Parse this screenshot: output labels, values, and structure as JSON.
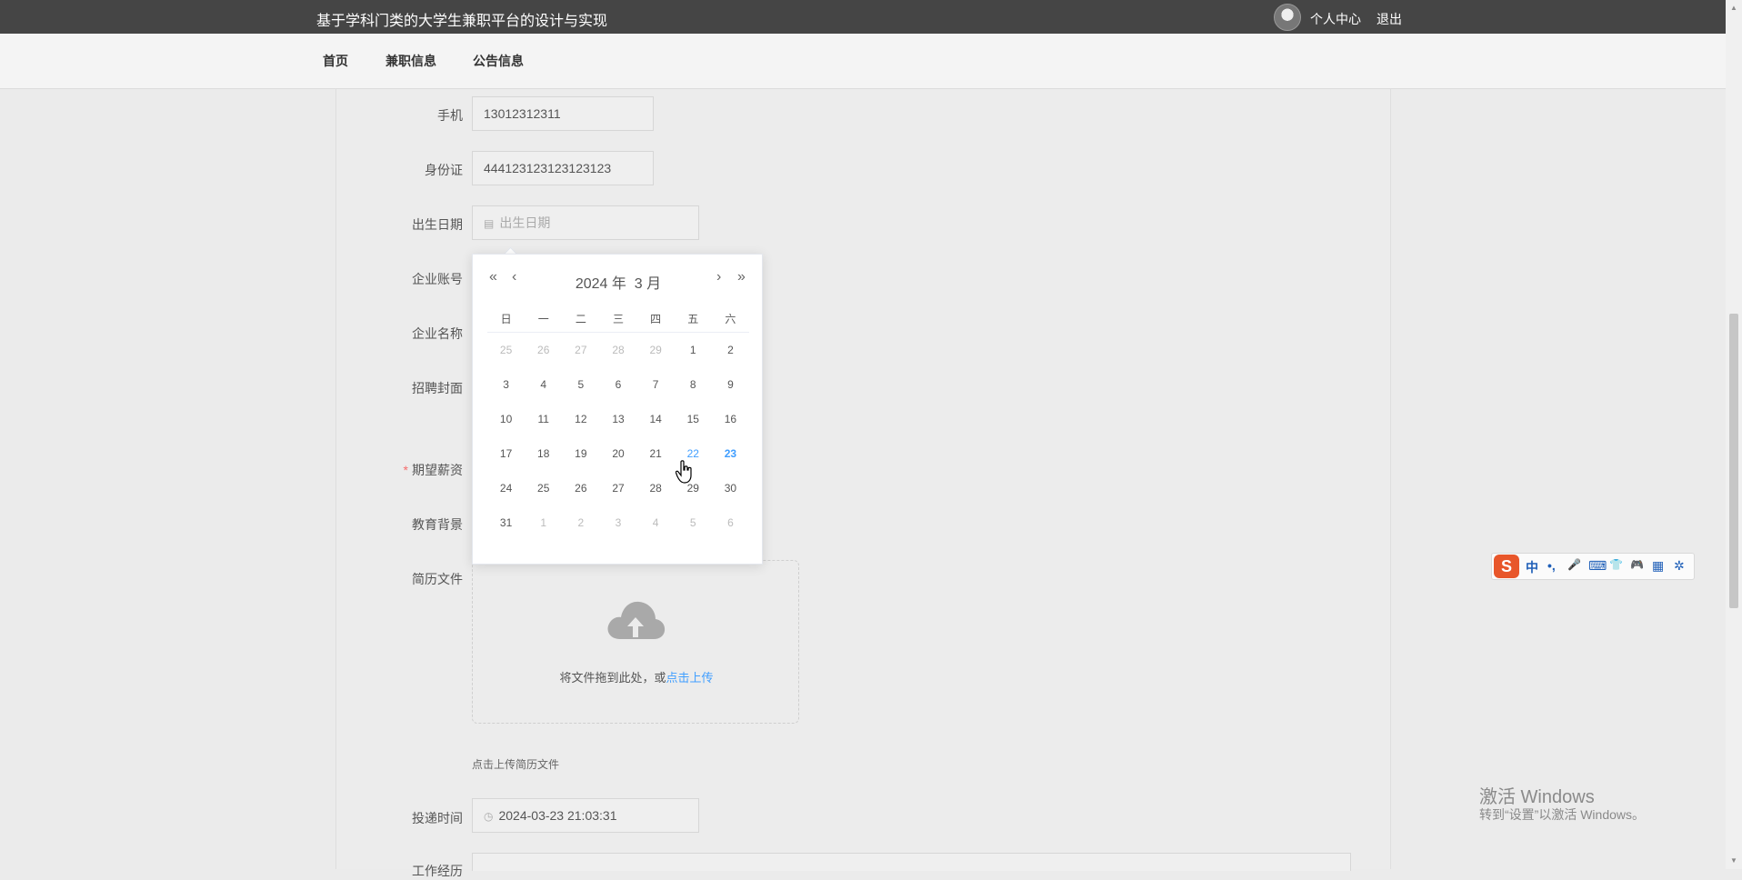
{
  "header": {
    "site_title": "基于学科门类的大学生兼职平台的设计与实现",
    "personal_center": "个人中心",
    "logout": "退出"
  },
  "nav": {
    "items": [
      {
        "label": "首页"
      },
      {
        "label": "兼职信息"
      },
      {
        "label": "公告信息"
      }
    ]
  },
  "form": {
    "phone": {
      "label": "手机",
      "value": "13012312311"
    },
    "id_card": {
      "label": "身份证",
      "value": "444123123123123123"
    },
    "birth_date": {
      "label": "出生日期",
      "placeholder": "出生日期"
    },
    "company_account": {
      "label": "企业账号"
    },
    "company_name": {
      "label": "企业名称"
    },
    "recruit_cover": {
      "label": "招聘封面"
    },
    "expected_salary": {
      "label": "期望薪资",
      "required_mark": "*"
    },
    "education": {
      "label": "教育背景"
    },
    "resume_file": {
      "label": "简历文件"
    },
    "upload": {
      "text": "将文件拖到此处，或",
      "link": "点击上传",
      "hint": "点击上传简历文件"
    },
    "submit_time": {
      "label": "投递时间",
      "value": "2024-03-23 21:03:31"
    },
    "work_experience": {
      "label": "工作经历"
    }
  },
  "datepicker": {
    "prev_year": "«",
    "prev_month": "‹",
    "next_month": "›",
    "next_year": "»",
    "year_text": "2024 年",
    "month_text": "3 月",
    "weekdays": [
      "日",
      "一",
      "二",
      "三",
      "四",
      "五",
      "六"
    ],
    "weeks": [
      [
        {
          "d": "25",
          "t": "other"
        },
        {
          "d": "26",
          "t": "other"
        },
        {
          "d": "27",
          "t": "other"
        },
        {
          "d": "28",
          "t": "other"
        },
        {
          "d": "29",
          "t": "other"
        },
        {
          "d": "1",
          "t": ""
        },
        {
          "d": "2",
          "t": ""
        }
      ],
      [
        {
          "d": "3",
          "t": ""
        },
        {
          "d": "4",
          "t": ""
        },
        {
          "d": "5",
          "t": ""
        },
        {
          "d": "6",
          "t": ""
        },
        {
          "d": "7",
          "t": ""
        },
        {
          "d": "8",
          "t": ""
        },
        {
          "d": "9",
          "t": ""
        }
      ],
      [
        {
          "d": "10",
          "t": ""
        },
        {
          "d": "11",
          "t": ""
        },
        {
          "d": "12",
          "t": ""
        },
        {
          "d": "13",
          "t": ""
        },
        {
          "d": "14",
          "t": ""
        },
        {
          "d": "15",
          "t": ""
        },
        {
          "d": "16",
          "t": ""
        }
      ],
      [
        {
          "d": "17",
          "t": ""
        },
        {
          "d": "18",
          "t": ""
        },
        {
          "d": "19",
          "t": ""
        },
        {
          "d": "20",
          "t": ""
        },
        {
          "d": "21",
          "t": ""
        },
        {
          "d": "22",
          "t": "hover"
        },
        {
          "d": "23",
          "t": "today"
        }
      ],
      [
        {
          "d": "24",
          "t": ""
        },
        {
          "d": "25",
          "t": ""
        },
        {
          "d": "26",
          "t": ""
        },
        {
          "d": "27",
          "t": ""
        },
        {
          "d": "28",
          "t": ""
        },
        {
          "d": "29",
          "t": ""
        },
        {
          "d": "30",
          "t": ""
        }
      ],
      [
        {
          "d": "31",
          "t": ""
        },
        {
          "d": "1",
          "t": "other"
        },
        {
          "d": "2",
          "t": "other"
        },
        {
          "d": "3",
          "t": "other"
        },
        {
          "d": "4",
          "t": "other"
        },
        {
          "d": "5",
          "t": "other"
        },
        {
          "d": "6",
          "t": "other"
        }
      ]
    ]
  },
  "ime": {
    "logo": "S",
    "items": [
      "中",
      "•,",
      "🎤",
      "⌨",
      "👕",
      "🎮",
      "▦",
      "✲"
    ]
  },
  "watermark": {
    "line1": "激活 Windows",
    "line2": "转到“设置”以激活 Windows。"
  },
  "icons": {
    "calendar": "calendar-icon",
    "clock": "clock-icon",
    "upload": "cloud-upload-icon"
  },
  "colors": {
    "accent": "#409eff",
    "header_bg": "#454545",
    "required": "#f56c6c"
  }
}
